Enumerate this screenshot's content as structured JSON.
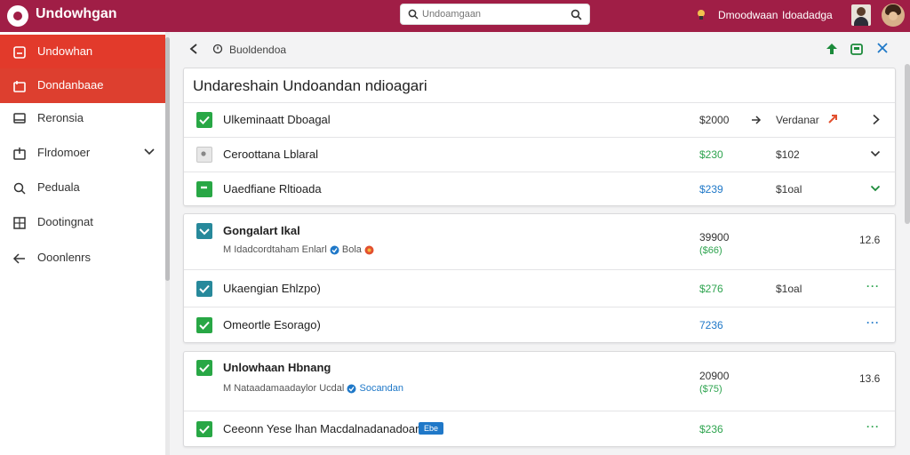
{
  "app": {
    "title": "Undowhgan"
  },
  "search": {
    "placeholder": "Undoamgaan"
  },
  "header": {
    "user_name": "Dmoodwaan",
    "role": "Idoadadga"
  },
  "sidebar": {
    "items": [
      {
        "label": "Undowhan",
        "icon": "clipboard-icon"
      },
      {
        "label": "Dondanbaae",
        "icon": "inbox-icon"
      },
      {
        "label": "Reronsia",
        "icon": "monitor-icon"
      },
      {
        "label": "Flrdomoer",
        "icon": "upload-icon"
      },
      {
        "label": "Peduala",
        "icon": "search-icon"
      },
      {
        "label": "Dootingnat",
        "icon": "grid-icon"
      },
      {
        "label": "Ooonlenrs",
        "icon": "arrow-left-icon"
      }
    ]
  },
  "toolbar": {
    "breadcrumb": "Buoldendoa"
  },
  "card1": {
    "title": "Undareshain Undoandan ndioagari",
    "rows": [
      {
        "label": "Ulkeminaatt Dboagal",
        "value": "$2000",
        "value2": "Verdanar"
      },
      {
        "label": "Ceroottana Lblaral",
        "value": "$230",
        "value2": "$102"
      },
      {
        "label": "Uaedfiane Rltioada",
        "value": "$239",
        "value2": "$1oal"
      }
    ]
  },
  "card2": {
    "header": {
      "label": "Gongalart Ikal",
      "sub": "M Idadcordtaham Enlarl",
      "badge": "Bola",
      "value": "39900",
      "value_sub": "($66)",
      "value3": "12.6"
    },
    "rows": [
      {
        "label": "Ukaengian Ehlzpo)",
        "value": "$276",
        "value2": "$1oal",
        "dots": "···"
      },
      {
        "label": "Omeortle Esorago)",
        "value": "7236",
        "dots": "···"
      }
    ]
  },
  "card3": {
    "header": {
      "label": "Unlowhaan Hbnang",
      "sub": "M Nataadamaadaylor Ucdal",
      "badge": "Socandan",
      "value": "20900",
      "value_sub": "($75)",
      "value3": "13.6"
    },
    "rows": [
      {
        "label": "Ceeonn Yese lhan Macdalnadanadoars",
        "tag": "Ebe",
        "value": "$236",
        "dots": "···"
      }
    ]
  },
  "colors": {
    "brand": "#a01e46",
    "accent": "#e23a2b",
    "positive": "#2ea44f",
    "link": "#1f78c8"
  }
}
